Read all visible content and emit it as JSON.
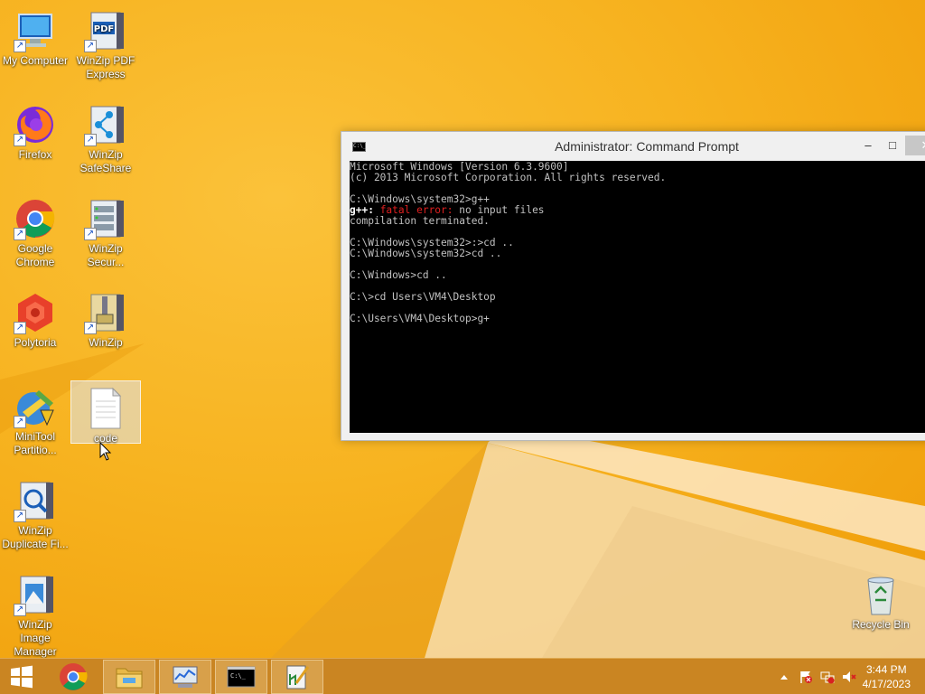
{
  "desktop": {
    "icons": [
      {
        "label": "My Computer",
        "icon": "computer-icon"
      },
      {
        "label": "WinZip PDF Express",
        "icon": "winzip-pdf-icon"
      },
      {
        "label": "Firefox",
        "icon": "firefox-icon"
      },
      {
        "label": "WinZip SafeShare",
        "icon": "winzip-safeshare-icon"
      },
      {
        "label": "Google Chrome",
        "icon": "chrome-icon"
      },
      {
        "label": "WinZip Secur...",
        "icon": "winzip-secure-icon"
      },
      {
        "label": "Polytoria",
        "icon": "polytoria-icon"
      },
      {
        "label": "WinZip",
        "icon": "winzip-icon"
      },
      {
        "label": "MiniTool Partitio...",
        "icon": "minitool-icon"
      },
      {
        "label": "code",
        "icon": "text-file-icon",
        "selected": true
      },
      {
        "label": "WinZip Duplicate Fi...",
        "icon": "winzip-duplicate-icon"
      },
      {
        "label": "WinZip Image Manager",
        "icon": "winzip-image-icon"
      },
      {
        "label": "Recycle Bin",
        "icon": "recycle-bin-icon"
      }
    ]
  },
  "cmd_window": {
    "title": "Administrator:  Command Prompt",
    "app_icon_text": "C:\\_",
    "minimize": "–",
    "maximize": "□",
    "close": "✕",
    "lines": [
      {
        "text": "Microsoft Windows [Version 6.3.9600]"
      },
      {
        "text": "(c) 2013 Microsoft Corporation. All rights reserved."
      },
      {
        "text": ""
      },
      {
        "text": "C:\\Windows\\system32>g++"
      },
      {
        "segments": [
          {
            "text": "g++: ",
            "style": "white"
          },
          {
            "text": "fatal error:",
            "style": "red"
          },
          {
            "text": " no input files",
            "style": "normal"
          }
        ]
      },
      {
        "text": "compilation terminated."
      },
      {
        "text": ""
      },
      {
        "text": "C:\\Windows\\system32>:>cd .."
      },
      {
        "text": "C:\\Windows\\system32>cd .."
      },
      {
        "text": ""
      },
      {
        "text": "C:\\Windows>cd .."
      },
      {
        "text": ""
      },
      {
        "text": "C:\\>cd Users\\VM4\\Desktop"
      },
      {
        "text": ""
      },
      {
        "text": "C:\\Users\\VM4\\Desktop>g+"
      }
    ]
  },
  "taskbar": {
    "start_icon": "windows-logo-icon",
    "apps": [
      {
        "name": "Google Chrome",
        "icon": "chrome-icon"
      },
      {
        "name": "File Explorer",
        "icon": "folder-icon"
      },
      {
        "name": "Resource Monitor",
        "icon": "monitor-chart-icon"
      },
      {
        "name": "Command Prompt",
        "icon": "cmd-icon"
      },
      {
        "name": "Editor",
        "icon": "editor-icon"
      }
    ],
    "tray_icons": [
      "show-hidden-icons-arrow",
      "action-center-flag-icon",
      "network-icon",
      "volume-muted-icon"
    ],
    "clock": {
      "time": "3:44 PM",
      "date": "4/17/2023"
    }
  },
  "colors": {
    "wallpaper": "#f7b320",
    "taskbar": "#c4780a",
    "console_bg": "#000000",
    "console_text": "#c0c0c0",
    "error_red": "#e02020"
  }
}
